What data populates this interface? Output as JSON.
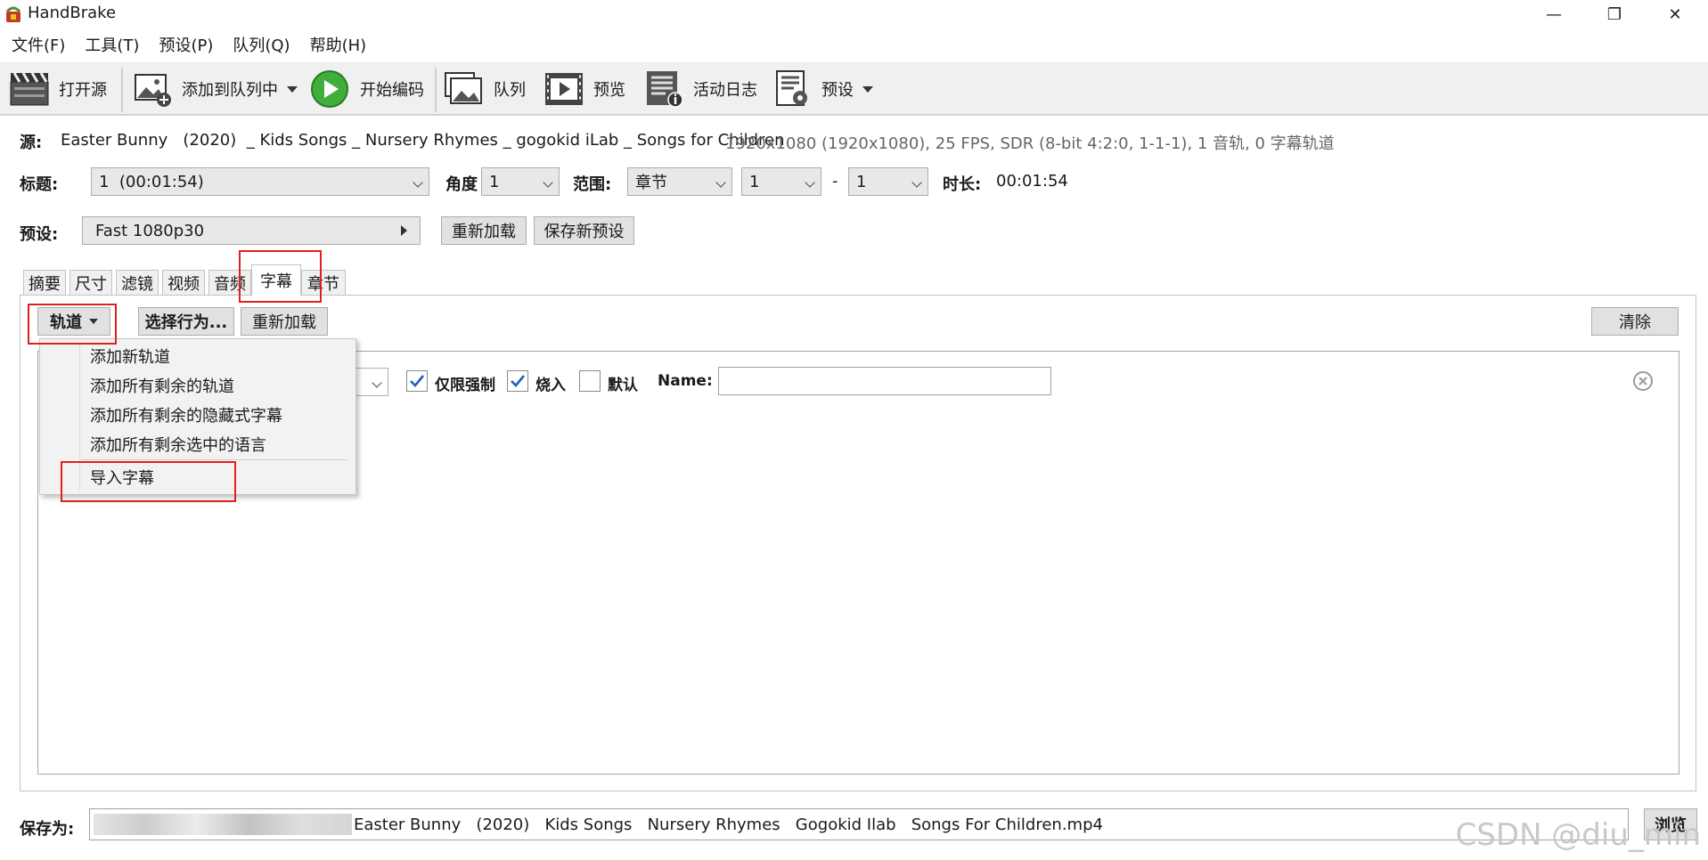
{
  "window": {
    "title": "HandBrake",
    "minimize": "—",
    "restore": "❐",
    "close": "✕"
  },
  "menu": [
    "文件(F)",
    "工具(T)",
    "预设(P)",
    "队列(Q)",
    "帮助(H)"
  ],
  "toolbar": {
    "open_source": "打开源",
    "add_to_queue": "添加到队列中",
    "start_encode": "开始编码",
    "queue": "队列",
    "preview": "预览",
    "activity_log": "活动日志",
    "presets": "预设"
  },
  "source": {
    "label": "源:",
    "name": "Easter Bunny   (2020)  _ Kids Songs _ Nursery Rhymes _ gogokid iLab _ Songs for Children",
    "info": "1920x1080 (1920x1080), 25 FPS, SDR (8-bit 4:2:0, 1-1-1), 1 音轨, 0 字幕轨道"
  },
  "title_row": {
    "title_label": "标题:",
    "title_value": "1  (00:01:54)",
    "angle_label": "角度",
    "angle_value": "1",
    "range_label": "范围:",
    "range_type": "章节",
    "range_start": "1",
    "range_dash": "-",
    "range_end": "1",
    "duration_label": "时长:",
    "duration_value": "00:01:54"
  },
  "preset_row": {
    "label": "预设:",
    "value": "Fast 1080p30",
    "reload": "重新加载",
    "save_new": "保存新预设"
  },
  "tabs": [
    "摘要",
    "尺寸",
    "滤镜",
    "视频",
    "音频",
    "字幕",
    "章节"
  ],
  "subtitle_tab": {
    "tracks_button": "轨道",
    "select_behavior": "选择行为...",
    "reload": "重新加载",
    "clear": "清除",
    "forced_only": "仅限强制",
    "burn_in": "烧入",
    "default": "默认",
    "name_label": "Name:",
    "name_value": ""
  },
  "tracks_menu": [
    "添加新轨道",
    "添加所有剩余的轨道",
    "添加所有剩余的隐藏式字幕",
    "添加所有剩余选中的语言",
    "导入字幕"
  ],
  "save_row": {
    "label": "保存为:",
    "path_visible": "Easter Bunny   (2020)   Kids Songs   Nursery Rhymes   Gogokid Ilab   Songs For Children.mp4",
    "browse": "浏览"
  },
  "watermark": "CSDN @diu_min",
  "colors": {
    "highlight_red": "#e02020",
    "check_blue": "#1f5fbf",
    "play_green": "#3fae3a"
  }
}
